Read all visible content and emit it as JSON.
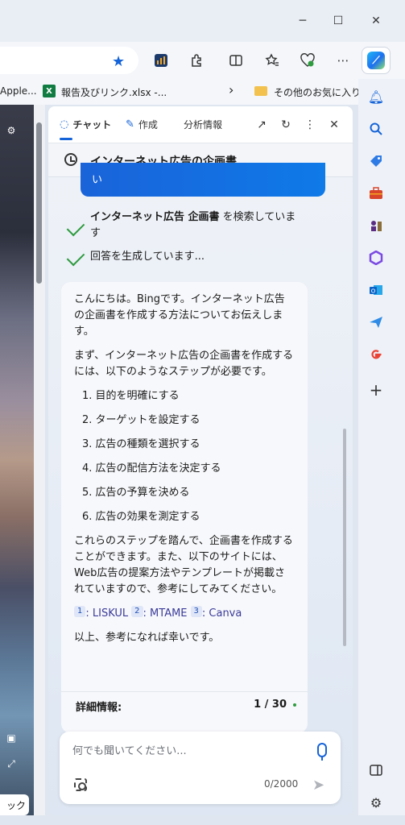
{
  "window": {
    "minimize": "─",
    "maximize": "☐",
    "close": "✕"
  },
  "toolbar": {
    "icons": [
      "stats-icon",
      "extensions-icon",
      "split-screen-icon",
      "favorites-icon",
      "browser-essentials-icon",
      "more-icon",
      "copilot-icon"
    ]
  },
  "bookmarks": {
    "item1": "Apple...",
    "item2": "報告及びリンク.xlsx -...",
    "chevron": "›",
    "other": "その他のお気に入り"
  },
  "photo": {
    "button_label": "ック"
  },
  "pane": {
    "tabs": {
      "chat": "チャット",
      "compose": "作成",
      "insights": "分析情報"
    },
    "conversation_title": "インターネット広告の企画書",
    "user_bubble_text": "い",
    "status": {
      "searching_bold": "インターネット広告 企画書",
      "searching_rest": " を検索しています",
      "generating": "回答を生成しています..."
    },
    "answer": {
      "intro": "こんにちは。Bingです。インターネット広告の企画書を作成する方法についてお伝えします。",
      "para2": "まず、インターネット広告の企画書を作成するには、以下のようなステップが必要です。",
      "steps": [
        "1. 目的を明確にする",
        "2. ターゲットを設定する",
        "3. 広告の種類を選択する",
        "4. 広告の配信方法を決定する",
        "5. 広告の予算を決める",
        "6. 広告の効果を測定する"
      ],
      "para3": "これらのステップを踏んで、企画書を作成することができます。また、以下のサイトには、Web広告の提案方法やテンプレートが掲載されていますので、参考にしてみてください。",
      "citations": [
        {
          "num": "1",
          "label": ": LISKUL"
        },
        {
          "num": "2",
          "label": ": MTAME"
        },
        {
          "num": "3",
          "label": ": Canva"
        }
      ],
      "closing": "以上、参考になれば幸いです。"
    },
    "details": {
      "label": "詳細情報:",
      "count": "1 / 30"
    },
    "input": {
      "placeholder": "何でも聞いてください...",
      "char_count": "0/2000"
    }
  },
  "colors": {
    "accent": "#1463d8",
    "check": "#2e9b3f",
    "excel": "#107c41"
  }
}
